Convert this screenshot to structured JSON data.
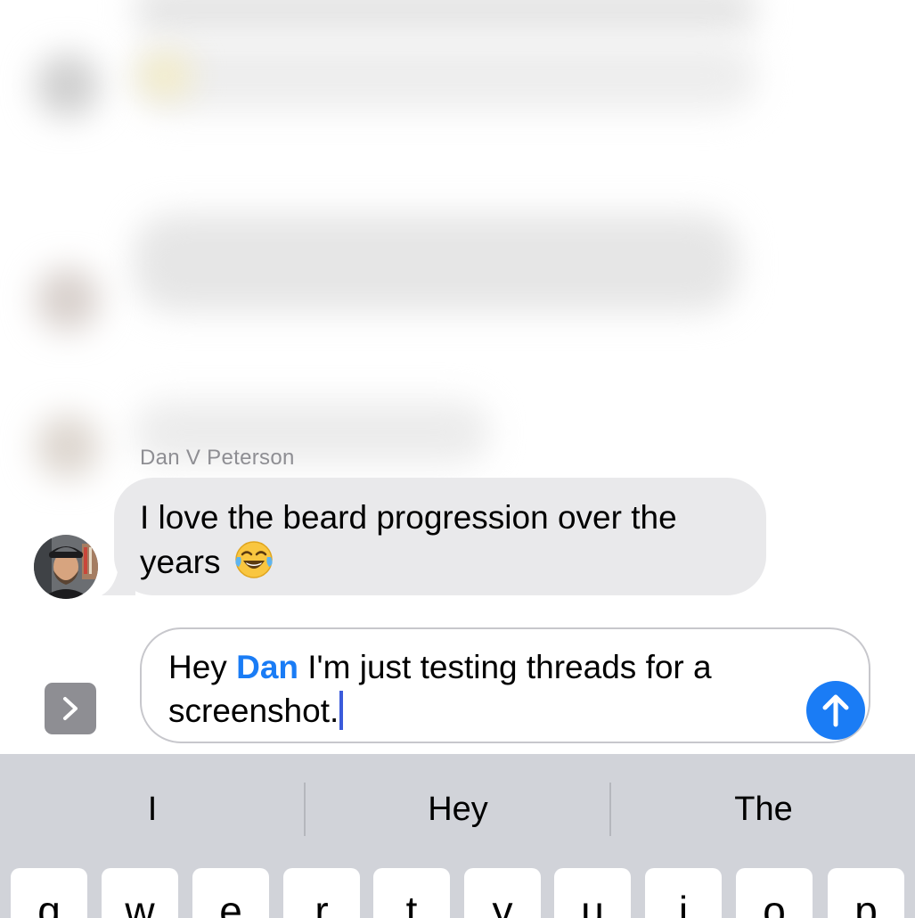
{
  "thread": {
    "sender_name": "Dan V Peterson",
    "message_text": "I love the beard progression over the years",
    "message_emoji": "face-with-tears-of-joy"
  },
  "compose": {
    "prefix": "Hey",
    "mention": "Dan",
    "suffix": "I'm just testing threads for a screenshot.",
    "accent_color": "#1a7cf5"
  },
  "keyboard": {
    "suggestions": [
      "I",
      "Hey",
      "The"
    ],
    "top_row": [
      "q",
      "w",
      "e",
      "r",
      "t",
      "y",
      "u",
      "i",
      "o",
      "p"
    ]
  },
  "colors": {
    "bubble_incoming": "#e9e9eb",
    "send_button": "#1a7cf5",
    "keyboard_bg": "#d1d3d9"
  }
}
